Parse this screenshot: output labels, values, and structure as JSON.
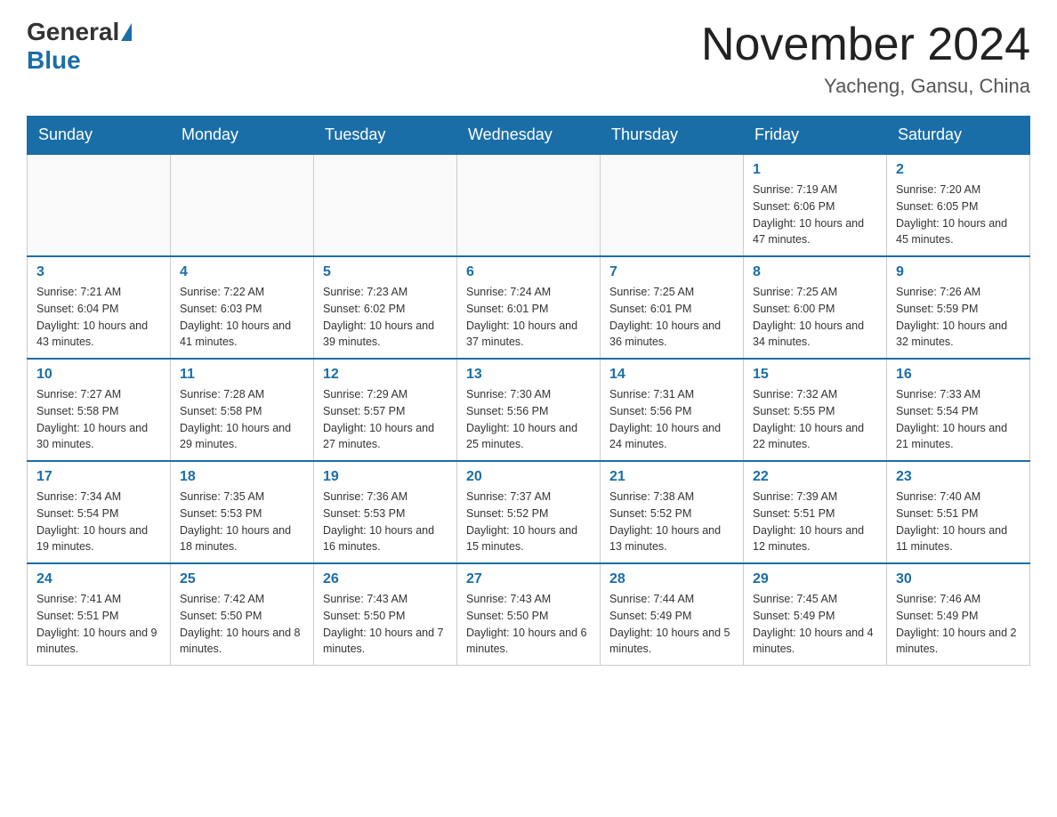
{
  "header": {
    "logo_general": "General",
    "logo_blue": "Blue",
    "month_title": "November 2024",
    "location": "Yacheng, Gansu, China"
  },
  "days_of_week": [
    "Sunday",
    "Monday",
    "Tuesday",
    "Wednesday",
    "Thursday",
    "Friday",
    "Saturday"
  ],
  "weeks": [
    [
      {
        "day": "",
        "info": ""
      },
      {
        "day": "",
        "info": ""
      },
      {
        "day": "",
        "info": ""
      },
      {
        "day": "",
        "info": ""
      },
      {
        "day": "",
        "info": ""
      },
      {
        "day": "1",
        "info": "Sunrise: 7:19 AM\nSunset: 6:06 PM\nDaylight: 10 hours and 47 minutes."
      },
      {
        "day": "2",
        "info": "Sunrise: 7:20 AM\nSunset: 6:05 PM\nDaylight: 10 hours and 45 minutes."
      }
    ],
    [
      {
        "day": "3",
        "info": "Sunrise: 7:21 AM\nSunset: 6:04 PM\nDaylight: 10 hours and 43 minutes."
      },
      {
        "day": "4",
        "info": "Sunrise: 7:22 AM\nSunset: 6:03 PM\nDaylight: 10 hours and 41 minutes."
      },
      {
        "day": "5",
        "info": "Sunrise: 7:23 AM\nSunset: 6:02 PM\nDaylight: 10 hours and 39 minutes."
      },
      {
        "day": "6",
        "info": "Sunrise: 7:24 AM\nSunset: 6:01 PM\nDaylight: 10 hours and 37 minutes."
      },
      {
        "day": "7",
        "info": "Sunrise: 7:25 AM\nSunset: 6:01 PM\nDaylight: 10 hours and 36 minutes."
      },
      {
        "day": "8",
        "info": "Sunrise: 7:25 AM\nSunset: 6:00 PM\nDaylight: 10 hours and 34 minutes."
      },
      {
        "day": "9",
        "info": "Sunrise: 7:26 AM\nSunset: 5:59 PM\nDaylight: 10 hours and 32 minutes."
      }
    ],
    [
      {
        "day": "10",
        "info": "Sunrise: 7:27 AM\nSunset: 5:58 PM\nDaylight: 10 hours and 30 minutes."
      },
      {
        "day": "11",
        "info": "Sunrise: 7:28 AM\nSunset: 5:58 PM\nDaylight: 10 hours and 29 minutes."
      },
      {
        "day": "12",
        "info": "Sunrise: 7:29 AM\nSunset: 5:57 PM\nDaylight: 10 hours and 27 minutes."
      },
      {
        "day": "13",
        "info": "Sunrise: 7:30 AM\nSunset: 5:56 PM\nDaylight: 10 hours and 25 minutes."
      },
      {
        "day": "14",
        "info": "Sunrise: 7:31 AM\nSunset: 5:56 PM\nDaylight: 10 hours and 24 minutes."
      },
      {
        "day": "15",
        "info": "Sunrise: 7:32 AM\nSunset: 5:55 PM\nDaylight: 10 hours and 22 minutes."
      },
      {
        "day": "16",
        "info": "Sunrise: 7:33 AM\nSunset: 5:54 PM\nDaylight: 10 hours and 21 minutes."
      }
    ],
    [
      {
        "day": "17",
        "info": "Sunrise: 7:34 AM\nSunset: 5:54 PM\nDaylight: 10 hours and 19 minutes."
      },
      {
        "day": "18",
        "info": "Sunrise: 7:35 AM\nSunset: 5:53 PM\nDaylight: 10 hours and 18 minutes."
      },
      {
        "day": "19",
        "info": "Sunrise: 7:36 AM\nSunset: 5:53 PM\nDaylight: 10 hours and 16 minutes."
      },
      {
        "day": "20",
        "info": "Sunrise: 7:37 AM\nSunset: 5:52 PM\nDaylight: 10 hours and 15 minutes."
      },
      {
        "day": "21",
        "info": "Sunrise: 7:38 AM\nSunset: 5:52 PM\nDaylight: 10 hours and 13 minutes."
      },
      {
        "day": "22",
        "info": "Sunrise: 7:39 AM\nSunset: 5:51 PM\nDaylight: 10 hours and 12 minutes."
      },
      {
        "day": "23",
        "info": "Sunrise: 7:40 AM\nSunset: 5:51 PM\nDaylight: 10 hours and 11 minutes."
      }
    ],
    [
      {
        "day": "24",
        "info": "Sunrise: 7:41 AM\nSunset: 5:51 PM\nDaylight: 10 hours and 9 minutes."
      },
      {
        "day": "25",
        "info": "Sunrise: 7:42 AM\nSunset: 5:50 PM\nDaylight: 10 hours and 8 minutes."
      },
      {
        "day": "26",
        "info": "Sunrise: 7:43 AM\nSunset: 5:50 PM\nDaylight: 10 hours and 7 minutes."
      },
      {
        "day": "27",
        "info": "Sunrise: 7:43 AM\nSunset: 5:50 PM\nDaylight: 10 hours and 6 minutes."
      },
      {
        "day": "28",
        "info": "Sunrise: 7:44 AM\nSunset: 5:49 PM\nDaylight: 10 hours and 5 minutes."
      },
      {
        "day": "29",
        "info": "Sunrise: 7:45 AM\nSunset: 5:49 PM\nDaylight: 10 hours and 4 minutes."
      },
      {
        "day": "30",
        "info": "Sunrise: 7:46 AM\nSunset: 5:49 PM\nDaylight: 10 hours and 2 minutes."
      }
    ]
  ]
}
